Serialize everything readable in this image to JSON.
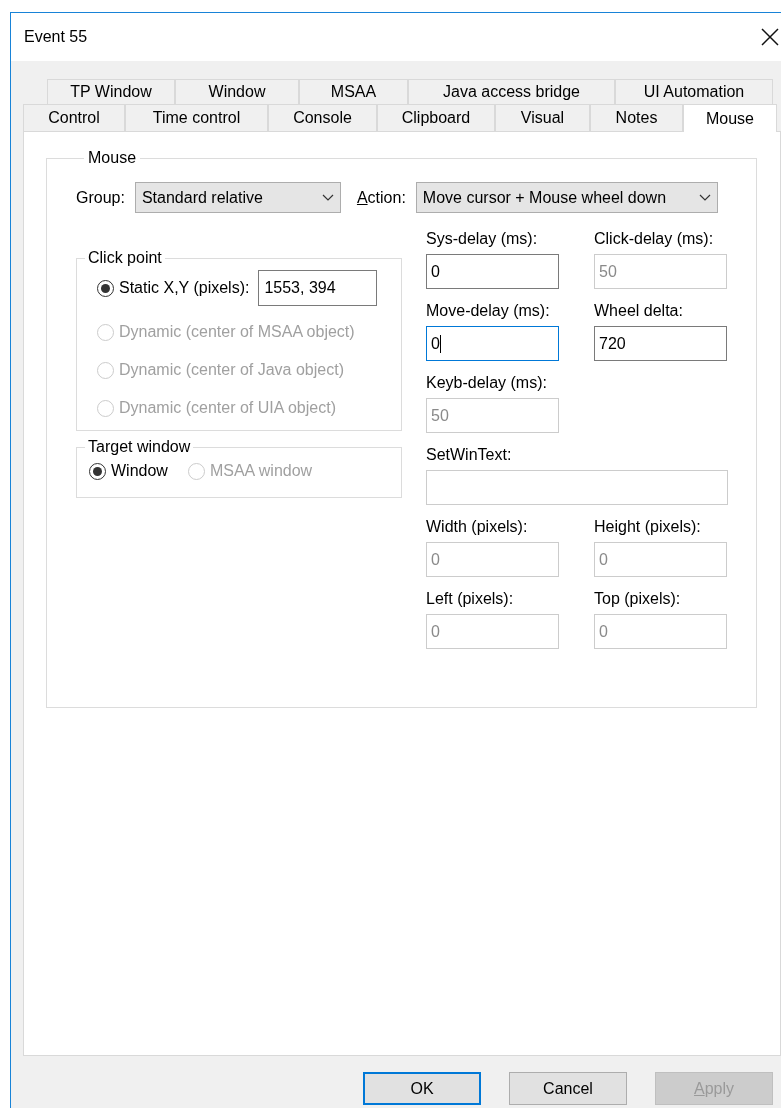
{
  "window": {
    "title": "Event 55"
  },
  "tab_rows": [
    [
      {
        "label": "TP Window",
        "selected": false
      },
      {
        "label": "Window",
        "selected": false
      },
      {
        "label": "MSAA",
        "selected": false
      },
      {
        "label": "Java access bridge",
        "selected": false
      },
      {
        "label": "UI Automation",
        "selected": false
      }
    ],
    [
      {
        "label": "Control",
        "selected": false
      },
      {
        "label": "Time control",
        "selected": false
      },
      {
        "label": "Console",
        "selected": false
      },
      {
        "label": "Clipboard",
        "selected": false
      },
      {
        "label": "Visual",
        "selected": false
      },
      {
        "label": "Notes",
        "selected": false
      },
      {
        "label": "Mouse",
        "selected": true
      }
    ]
  ],
  "mouse_group": {
    "title": "Mouse",
    "group": {
      "label": "Group:",
      "value": "Standard relative",
      "underline_first": false
    },
    "action": {
      "label": "Action:",
      "value": "Move cursor + Mouse wheel down",
      "underline_first": true
    },
    "click_point": {
      "title": "Click point",
      "options": [
        {
          "label": "Static X,Y (pixels):",
          "selected": true,
          "disabled": false,
          "value": "1553, 394"
        },
        {
          "label": "Dynamic (center of MSAA object)",
          "selected": false,
          "disabled": true
        },
        {
          "label": "Dynamic (center of Java object)",
          "selected": false,
          "disabled": true
        },
        {
          "label": "Dynamic (center of UIA object)",
          "selected": false,
          "disabled": true
        }
      ]
    },
    "target_window": {
      "title": "Target window",
      "options": [
        {
          "label": "Window",
          "selected": true,
          "disabled": false
        },
        {
          "label": "MSAA window",
          "selected": false,
          "disabled": true
        }
      ]
    },
    "fields": [
      {
        "label": "Sys-delay (ms):",
        "value": "0",
        "disabled": false,
        "focused": false,
        "wide": false
      },
      {
        "label": "Click-delay (ms):",
        "value": "50",
        "disabled": true,
        "focused": false,
        "wide": false
      },
      {
        "label": "Move-delay (ms):",
        "value": "0",
        "disabled": false,
        "focused": true,
        "wide": false
      },
      {
        "label": "Wheel delta:",
        "value": "720",
        "disabled": false,
        "focused": false,
        "wide": false
      },
      {
        "label": "Keyb-delay (ms):",
        "value": "50",
        "disabled": true,
        "focused": false,
        "wide": false
      },
      {
        "label": "SetWinText:",
        "disabled": true,
        "focused": false,
        "wide": true
      },
      {
        "label": "Width (pixels):",
        "value": "0",
        "disabled": true,
        "focused": false,
        "wide": false
      },
      {
        "label": "Height (pixels):",
        "value": "0",
        "disabled": true,
        "focused": false,
        "wide": false
      },
      {
        "label": "Left (pixels):",
        "value": "0",
        "disabled": true,
        "focused": false,
        "wide": false
      },
      {
        "label": "Top (pixels):",
        "value": "0",
        "disabled": true,
        "focused": false,
        "wide": false
      }
    ]
  },
  "buttons": [
    {
      "label": "OK",
      "default": true,
      "disabled": false,
      "underline_first": false
    },
    {
      "label": "Cancel",
      "default": false,
      "disabled": false,
      "underline_first": false
    },
    {
      "label": "Apply",
      "default": false,
      "disabled": true,
      "underline_first": true
    }
  ]
}
